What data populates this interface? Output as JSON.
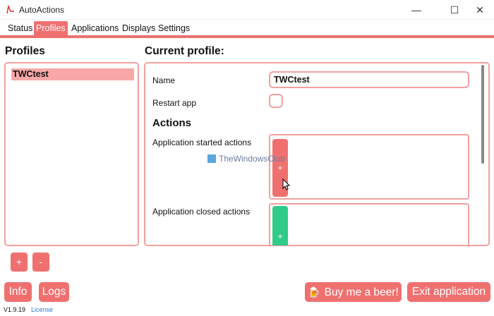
{
  "window": {
    "title": "AutoActions",
    "minimize": "—",
    "maximize": "☐",
    "close": "✕"
  },
  "tabs": [
    "Status",
    "Profiles",
    "Applications",
    "Displays",
    "Settings"
  ],
  "active_tab": "Profiles",
  "profiles": {
    "title": "Profiles",
    "items": [
      "TWCtest"
    ],
    "add_label": "+",
    "remove_label": "-"
  },
  "current_profile": {
    "title": "Current profile:",
    "name_label": "Name",
    "name_value": "TWCtest",
    "restart_label": "Restart app",
    "restart_checked": false,
    "actions_title": "Actions",
    "started_label": "Application started actions",
    "closed_label": "Application closed actions",
    "add_started_label": "+",
    "add_closed_label": "+"
  },
  "watermark": "TheWindowsClub",
  "footer": {
    "info_label": "Info",
    "logs_label": "Logs",
    "beer_label": "Buy me a beer!",
    "exit_label": "Exit application",
    "version": "V1.9.19",
    "license": "License"
  },
  "colors": {
    "accent": "#f07070",
    "accent_light": "#f2a0a0",
    "selection": "#f8a8a8",
    "green": "#2ecc88"
  },
  "icons": {
    "app": "app-logo-icon",
    "beer": "beer-icon",
    "cursor": "mouse-cursor-icon"
  }
}
